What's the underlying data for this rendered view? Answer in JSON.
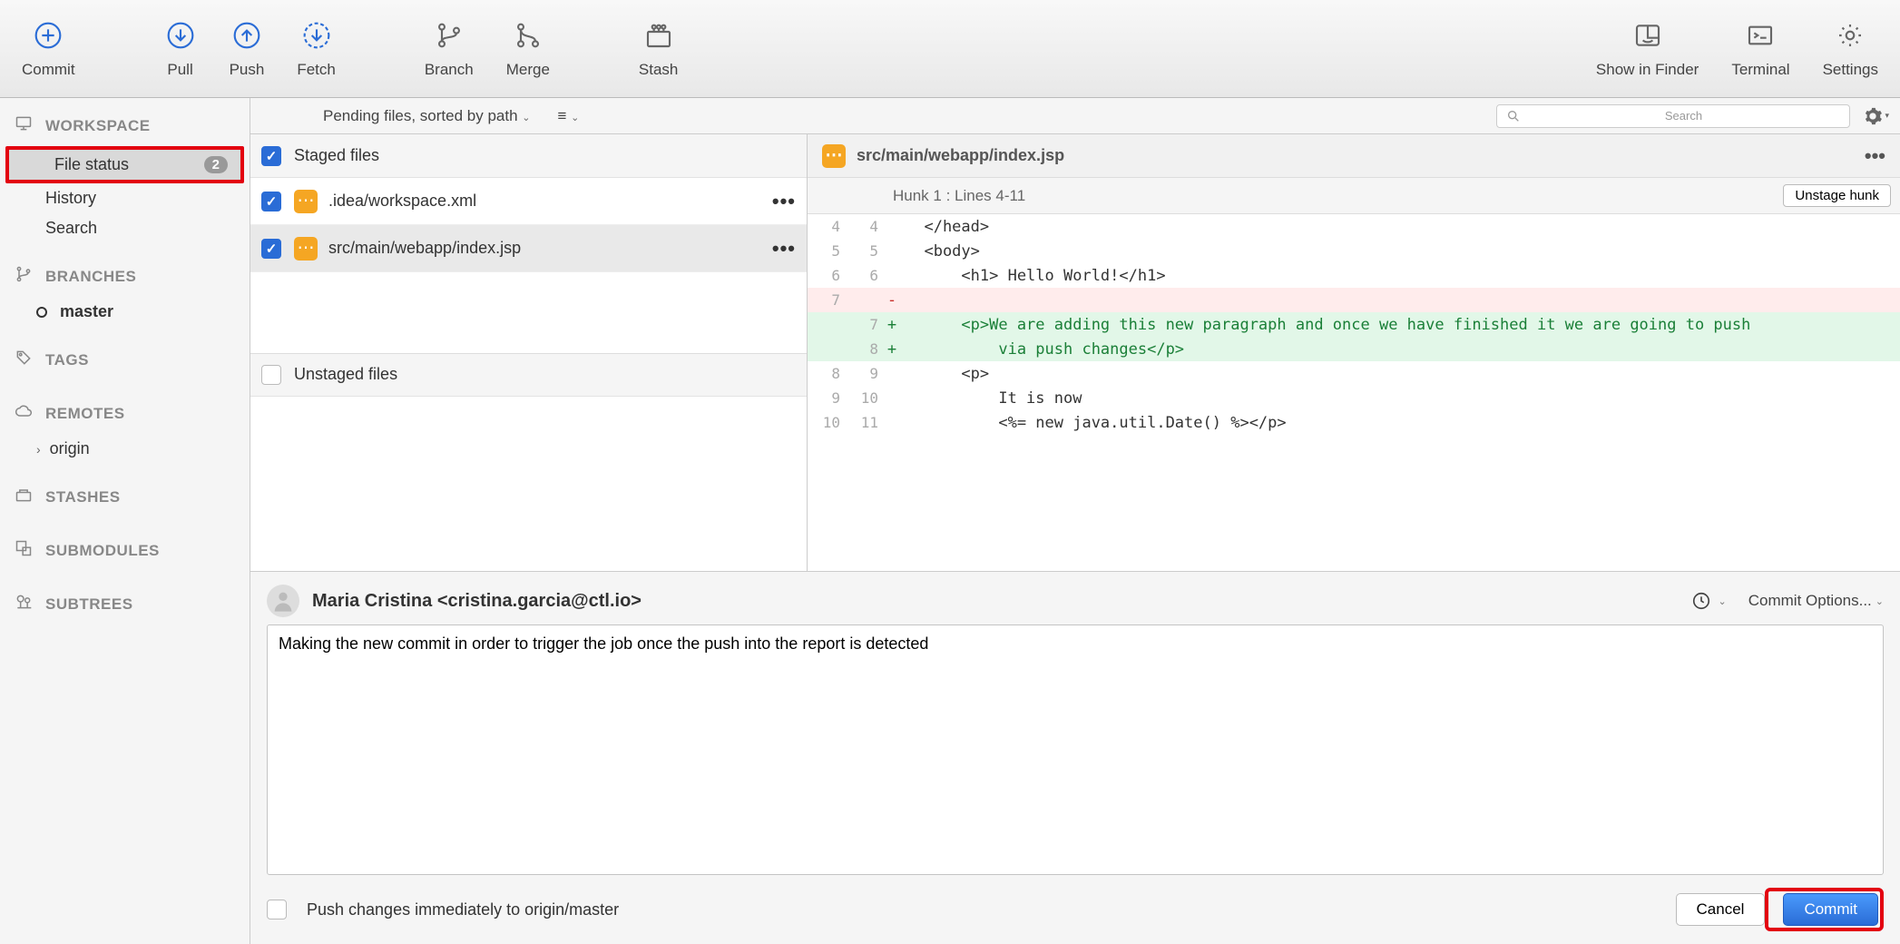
{
  "toolbar": {
    "left": [
      {
        "id": "commit",
        "label": "Commit"
      },
      {
        "id": "pull",
        "label": "Pull"
      },
      {
        "id": "push",
        "label": "Push"
      },
      {
        "id": "fetch",
        "label": "Fetch"
      },
      {
        "id": "branch",
        "label": "Branch"
      },
      {
        "id": "merge",
        "label": "Merge"
      },
      {
        "id": "stash",
        "label": "Stash"
      }
    ],
    "right": [
      {
        "id": "finder",
        "label": "Show in Finder"
      },
      {
        "id": "terminal",
        "label": "Terminal"
      },
      {
        "id": "settings",
        "label": "Settings"
      }
    ]
  },
  "sidebar": {
    "workspace": {
      "header": "WORKSPACE",
      "items": [
        {
          "label": "File status",
          "badge": "2",
          "selected": true
        },
        {
          "label": "History"
        },
        {
          "label": "Search"
        }
      ]
    },
    "branches": {
      "header": "BRANCHES",
      "items": [
        {
          "label": "master",
          "current": true
        }
      ]
    },
    "tags": {
      "header": "TAGS"
    },
    "remotes": {
      "header": "REMOTES",
      "items": [
        {
          "label": "origin",
          "expandable": true
        }
      ]
    },
    "stashes": {
      "header": "STASHES"
    },
    "submodules": {
      "header": "SUBMODULES"
    },
    "subtrees": {
      "header": "SUBTREES"
    }
  },
  "filterbar": {
    "pending_text": "Pending files, sorted by path",
    "search_placeholder": "Search"
  },
  "files": {
    "staged_header": "Staged files",
    "unstaged_header": "Unstaged files",
    "staged": [
      {
        "path": ".idea/workspace.xml",
        "selected": false
      },
      {
        "path": "src/main/webapp/index.jsp",
        "selected": true
      }
    ]
  },
  "diff": {
    "file": "src/main/webapp/index.jsp",
    "hunk_label": "Hunk 1 : Lines 4-11",
    "unstage_label": "Unstage hunk",
    "lines": [
      {
        "old": "4",
        "new": "4",
        "type": "ctx",
        "text": "  </head>"
      },
      {
        "old": "5",
        "new": "5",
        "type": "ctx",
        "text": "  <body>"
      },
      {
        "old": "6",
        "new": "6",
        "type": "ctx",
        "text": "      <h1> Hello World!</h1>"
      },
      {
        "old": "7",
        "new": "",
        "type": "removed",
        "text": ""
      },
      {
        "old": "",
        "new": "7",
        "type": "added",
        "text": "      <p>We are adding this new paragraph and once we have finished it we are going to push"
      },
      {
        "old": "",
        "new": "8",
        "type": "added",
        "text": "          via push changes</p>"
      },
      {
        "old": "8",
        "new": "9",
        "type": "ctx",
        "text": "      <p>"
      },
      {
        "old": "9",
        "new": "10",
        "type": "ctx",
        "text": "          It is now"
      },
      {
        "old": "10",
        "new": "11",
        "type": "ctx",
        "text": "          <%= new java.util.Date() %></p>"
      }
    ]
  },
  "commit": {
    "author": "Maria Cristina <cristina.garcia@ctl.io>",
    "options_label": "Commit Options...",
    "message": "Making the new commit in order to trigger the job once the push into the report is detected",
    "push_checkbox_label": "Push changes immediately to origin/master",
    "cancel_label": "Cancel",
    "commit_label": "Commit"
  }
}
